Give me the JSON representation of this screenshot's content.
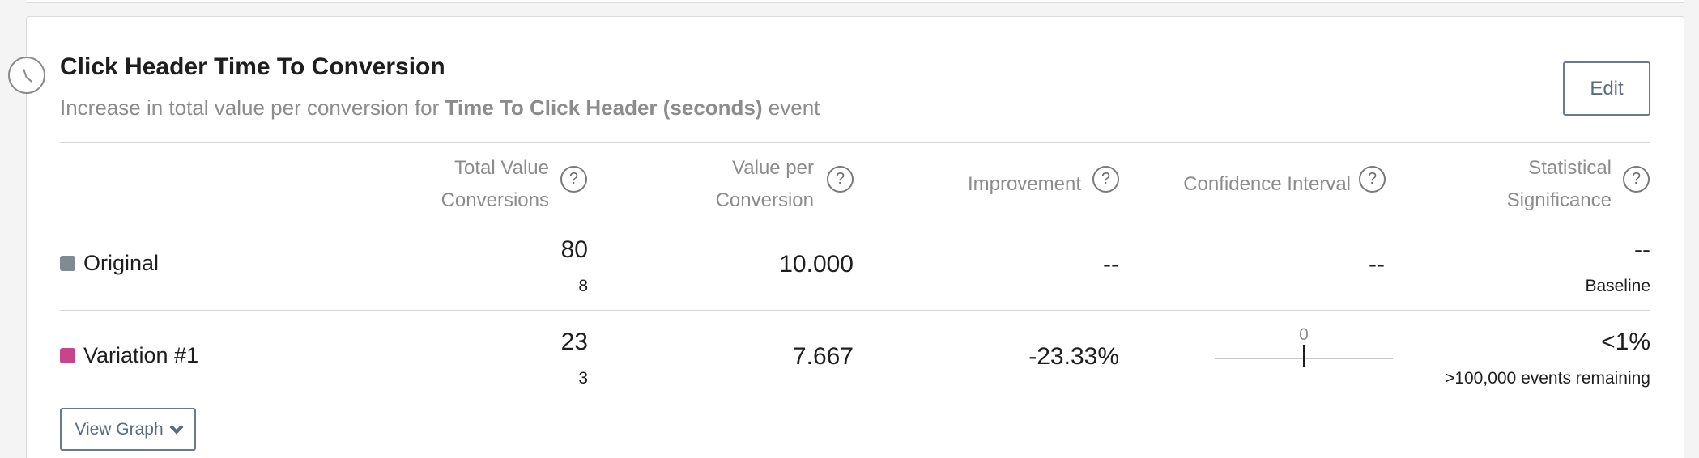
{
  "card": {
    "title": "Click Header Time To Conversion",
    "subtitle_prefix": "Increase in total value per conversion",
    "subtitle_for": "for",
    "subtitle_event_name": "Time To Click Header (seconds)",
    "subtitle_suffix": "event",
    "edit_label": "Edit",
    "icon": "clock-icon"
  },
  "columns": {
    "total_value_line1": "Total Value",
    "total_value_line2": "Conversions",
    "value_per_line1": "Value per",
    "value_per_line2": "Conversion",
    "improvement": "Improvement",
    "confidence_interval": "Confidence Interval",
    "significance_line1": "Statistical",
    "significance_line2": "Significance",
    "help_glyph": "?"
  },
  "rows": [
    {
      "label": "Original",
      "color": "#808a91",
      "total_value": "80",
      "conversions": "8",
      "value_per_conversion": "10.000",
      "improvement": "--",
      "confidence_interval": "--",
      "significance": "--",
      "significance_note": "Baseline"
    },
    {
      "label": "Variation #1",
      "color": "#c9458b",
      "total_value": "23",
      "conversions": "3",
      "value_per_conversion": "7.667",
      "improvement": "-23.33%",
      "confidence_interval_zero": "0",
      "significance": "<1%",
      "significance_note": ">100,000 events remaining"
    }
  ],
  "view_graph_label": "View Graph"
}
